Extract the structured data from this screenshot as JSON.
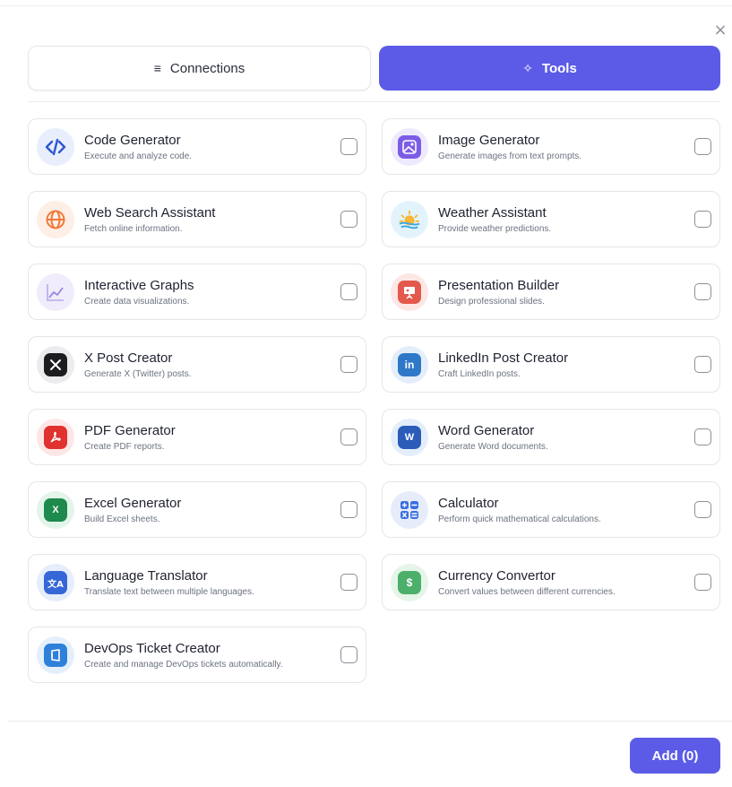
{
  "dialog": {
    "close_label": "×",
    "tabs": [
      {
        "label": "Connections",
        "icon": "≡",
        "active": false
      },
      {
        "label": "Tools",
        "icon": "✧",
        "active": true
      }
    ],
    "add_button_label": "Add (0)"
  },
  "colors": {
    "accent": "#5b5be8",
    "border": "#e3e6ea",
    "checkbox_border": "#8a8f98"
  },
  "tools": [
    {
      "title": "Code Generator",
      "description": "Execute and analyze code.",
      "icon": "code-icon",
      "checked": false
    },
    {
      "title": "Image Generator",
      "description": "Generate images from text prompts.",
      "icon": "image-icon",
      "checked": false
    },
    {
      "title": "Web Search Assistant",
      "description": "Fetch online information.",
      "icon": "globe-icon",
      "checked": false
    },
    {
      "title": "Weather Assistant",
      "description": "Provide weather predictions.",
      "icon": "sunrise-icon",
      "checked": false
    },
    {
      "title": "Interactive Graphs",
      "description": "Create data visualizations.",
      "icon": "graph-icon",
      "checked": false
    },
    {
      "title": "Presentation Builder",
      "description": "Design professional slides.",
      "icon": "presentation-icon",
      "checked": false
    },
    {
      "title": "X Post Creator",
      "description": "Generate X (Twitter) posts.",
      "icon": "x-logo-icon",
      "checked": false
    },
    {
      "title": "LinkedIn Post Creator",
      "description": "Craft LinkedIn posts.",
      "icon": "linkedin-icon",
      "checked": false
    },
    {
      "title": "PDF Generator",
      "description": "Create PDF reports.",
      "icon": "pdf-icon",
      "checked": false
    },
    {
      "title": "Word Generator",
      "description": "Generate Word documents.",
      "icon": "word-icon",
      "checked": false
    },
    {
      "title": "Excel Generator",
      "description": "Build Excel sheets.",
      "icon": "excel-icon",
      "checked": false
    },
    {
      "title": "Calculator",
      "description": "Perform quick mathematical calculations.",
      "icon": "calculator-icon",
      "checked": false
    },
    {
      "title": "Language Translator",
      "description": "Translate text between multiple languages.",
      "icon": "translate-icon",
      "checked": false
    },
    {
      "title": "Currency Convertor",
      "description": "Convert values between different currencies.",
      "icon": "currency-icon",
      "checked": false
    },
    {
      "title": "DevOps Ticket Creator",
      "description": "Create and manage DevOps tickets automatically.",
      "icon": "devops-icon",
      "checked": false
    }
  ]
}
